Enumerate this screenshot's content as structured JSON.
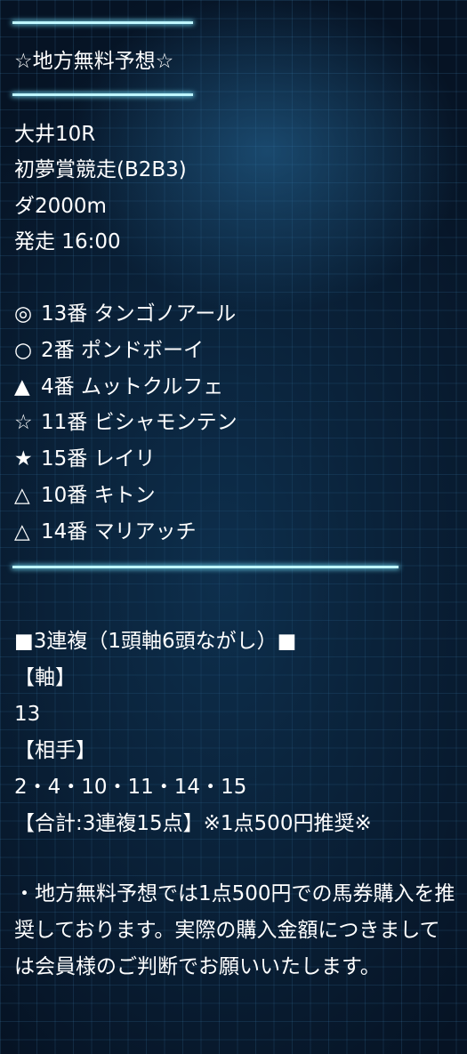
{
  "header": {
    "title": "☆地方無料予想☆"
  },
  "race": {
    "venue_round": "大井10R",
    "name": "初夢賞競走(B2B3)",
    "distance": "ダ2000m",
    "start": "発走 16:00"
  },
  "picks": [
    {
      "mark": "◎",
      "text": "13番 タンゴノアール"
    },
    {
      "mark": "○",
      "text": "2番 ポンドボーイ"
    },
    {
      "mark": "▲",
      "text": "4番 ムットクルフェ"
    },
    {
      "mark": "☆",
      "text": "11番 ビシャモンテン"
    },
    {
      "mark": "★",
      "text": "15番 レイリ"
    },
    {
      "mark": "△",
      "text": "10番 キトン"
    },
    {
      "mark": "△",
      "text": "14番 マリアッチ"
    }
  ],
  "bet": {
    "type": "■3連複（1頭軸6頭ながし）■",
    "axis_label": "【軸】",
    "axis_value": "13",
    "partners_label": "【相手】",
    "partners_value": "2・4・10・11・14・15",
    "total": "【合計:3連複15点】※1点500円推奨※"
  },
  "notice": "・地方無料予想では1点500円での馬券購入を推奨しております。実際の購入金額につきましては会員様のご判断でお願いいたします。"
}
